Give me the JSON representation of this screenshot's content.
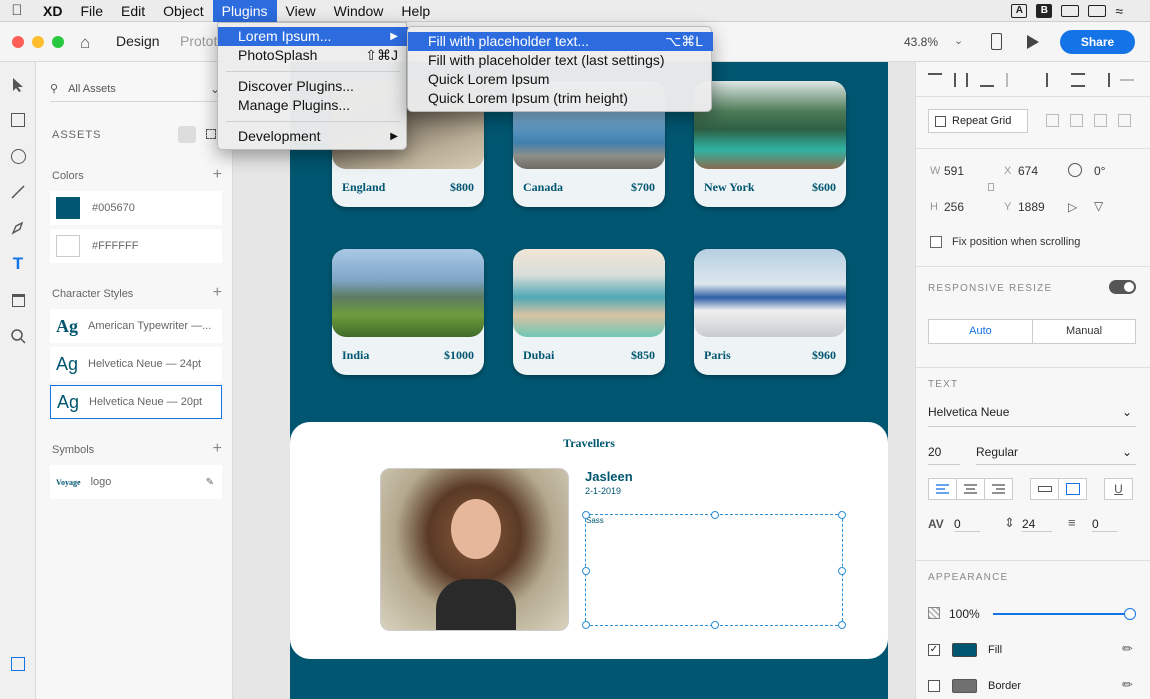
{
  "menubar": {
    "items": [
      "XD",
      "File",
      "Edit",
      "Object",
      "Plugins",
      "View",
      "Window",
      "Help"
    ]
  },
  "titlebar": {
    "tab_design": "Design",
    "tab_prototype": "Protot",
    "zoom": "43.8%",
    "share": "Share"
  },
  "assets": {
    "search_label": "All Assets",
    "heading": "ASSETS",
    "colors_heading": "Colors",
    "colors": [
      {
        "hex": "#005670",
        "label": "#005670"
      },
      {
        "hex": "#FFFFFF",
        "label": "#FFFFFF"
      }
    ],
    "char_styles_heading": "Character Styles",
    "char_styles": [
      {
        "glyph": "Ag",
        "label": "American Typewriter —..."
      },
      {
        "glyph": "Ag",
        "label": "Helvetica Neue — 24pt"
      },
      {
        "glyph": "Ag",
        "label": "Helvetica Neue — 20pt"
      }
    ],
    "symbols_heading": "Symbols",
    "symbol": {
      "thumb": "Voyage",
      "label": "logo"
    }
  },
  "canvas": {
    "cards": [
      {
        "name": "England",
        "price": "$800"
      },
      {
        "name": "Canada",
        "price": "$700"
      },
      {
        "name": "New York",
        "price": "$600"
      },
      {
        "name": "India",
        "price": "$1000"
      },
      {
        "name": "Dubai",
        "price": "$850"
      },
      {
        "name": "Paris",
        "price": "$960"
      }
    ],
    "travellers": {
      "title": "Travellers",
      "name": "Jasleen",
      "date": "2-1-2019",
      "textbox": "Sass"
    }
  },
  "props": {
    "repeat_grid": "Repeat Grid",
    "w_label": "W",
    "w": "591",
    "x_label": "X",
    "x": "674",
    "h_label": "H",
    "h": "256",
    "y_label": "Y",
    "y": "1889",
    "rotation": "0°",
    "fix_position": "Fix position when scrolling",
    "responsive_resize": "RESPONSIVE RESIZE",
    "auto": "Auto",
    "manual": "Manual",
    "text_heading": "TEXT",
    "font": "Helvetica Neue",
    "font_size": "20",
    "font_weight": "Regular",
    "char_spacing": "0",
    "line_spacing": "24",
    "para_spacing": "0",
    "appearance_heading": "APPEARANCE",
    "opacity": "100%",
    "fill": "Fill",
    "border": "Border"
  },
  "plugins_menu": {
    "items": [
      "Lorem Ipsum...",
      "PhotoSplash",
      "Discover Plugins...",
      "Manage Plugins...",
      "Development"
    ],
    "photosplash_shortcut": "⇧⌘J"
  },
  "lorem_submenu": {
    "items": [
      "Fill with placeholder text...",
      "Fill with placeholder text (last settings)",
      "Quick Lorem Ipsum",
      "Quick Lorem Ipsum (trim height)"
    ],
    "shortcut": "⌥⌘L"
  },
  "colors": {
    "accent": "#005670",
    "menu_highlight": "#2d6cdf",
    "share": "#1473e6"
  }
}
